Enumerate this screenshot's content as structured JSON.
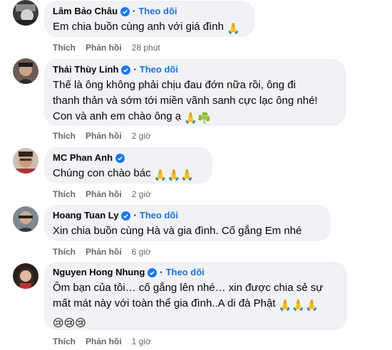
{
  "comments": [
    {
      "name": "Lâm Bảo Châu",
      "follow": "Theo dõi",
      "text_lines": [
        "Em chia buồn cùng anh với giá đình"
      ],
      "emoji": "🙏",
      "like": "Thích",
      "reply": "Phản hồi",
      "time": "28 phút"
    },
    {
      "name": "Thái Thùy Linh",
      "follow": "Theo dõi",
      "text_lines": [
        "Thế là ông không phải chịu đau đớn nữa rồi, ông đi",
        "thanh thản và sớm tới miền vãnh sanh cực lạc ông nhé!",
        "Con và anh em chào ông ạ"
      ],
      "emoji": "🙏☘️",
      "like": "Thích",
      "reply": "Phản hồi",
      "time": "2 giờ"
    },
    {
      "name": "MC Phan Anh",
      "follow": "",
      "text_lines": [
        "Chúng con chào bác"
      ],
      "emoji": "🙏🙏🙏",
      "like": "Thích",
      "reply": "Phản hồi",
      "time": "2 giờ"
    },
    {
      "name": "Hoang Tuan Ly",
      "follow": "Theo dõi",
      "text_lines": [
        "Xin chia buồn cùng Hà và gia đình. Cố gắng Em nhé"
      ],
      "emoji": "",
      "like": "Thích",
      "reply": "Phản hồi",
      "time": "6 giờ"
    },
    {
      "name": "Nguyen Hong Nhung",
      "follow": "Theo dõi",
      "text_lines": [
        "Ôm bạn của tôi… cố gắng lên nhé… xin được chia sẻ sự",
        "mất mát này với toàn thể gia đình..A di đà Phật",
        ""
      ],
      "emoji": "🙏🙏🙏",
      "emoji_line3": "😢😢😢",
      "like": "Thích",
      "reply": "Phản hồi",
      "time": "1 giờ"
    }
  ],
  "colors": {
    "bubble": "#f0f2f5",
    "link": "#216fdb",
    "muted": "#65676b",
    "verified": "#1877f2"
  },
  "icons": {
    "verified": "verified-badge-icon"
  }
}
